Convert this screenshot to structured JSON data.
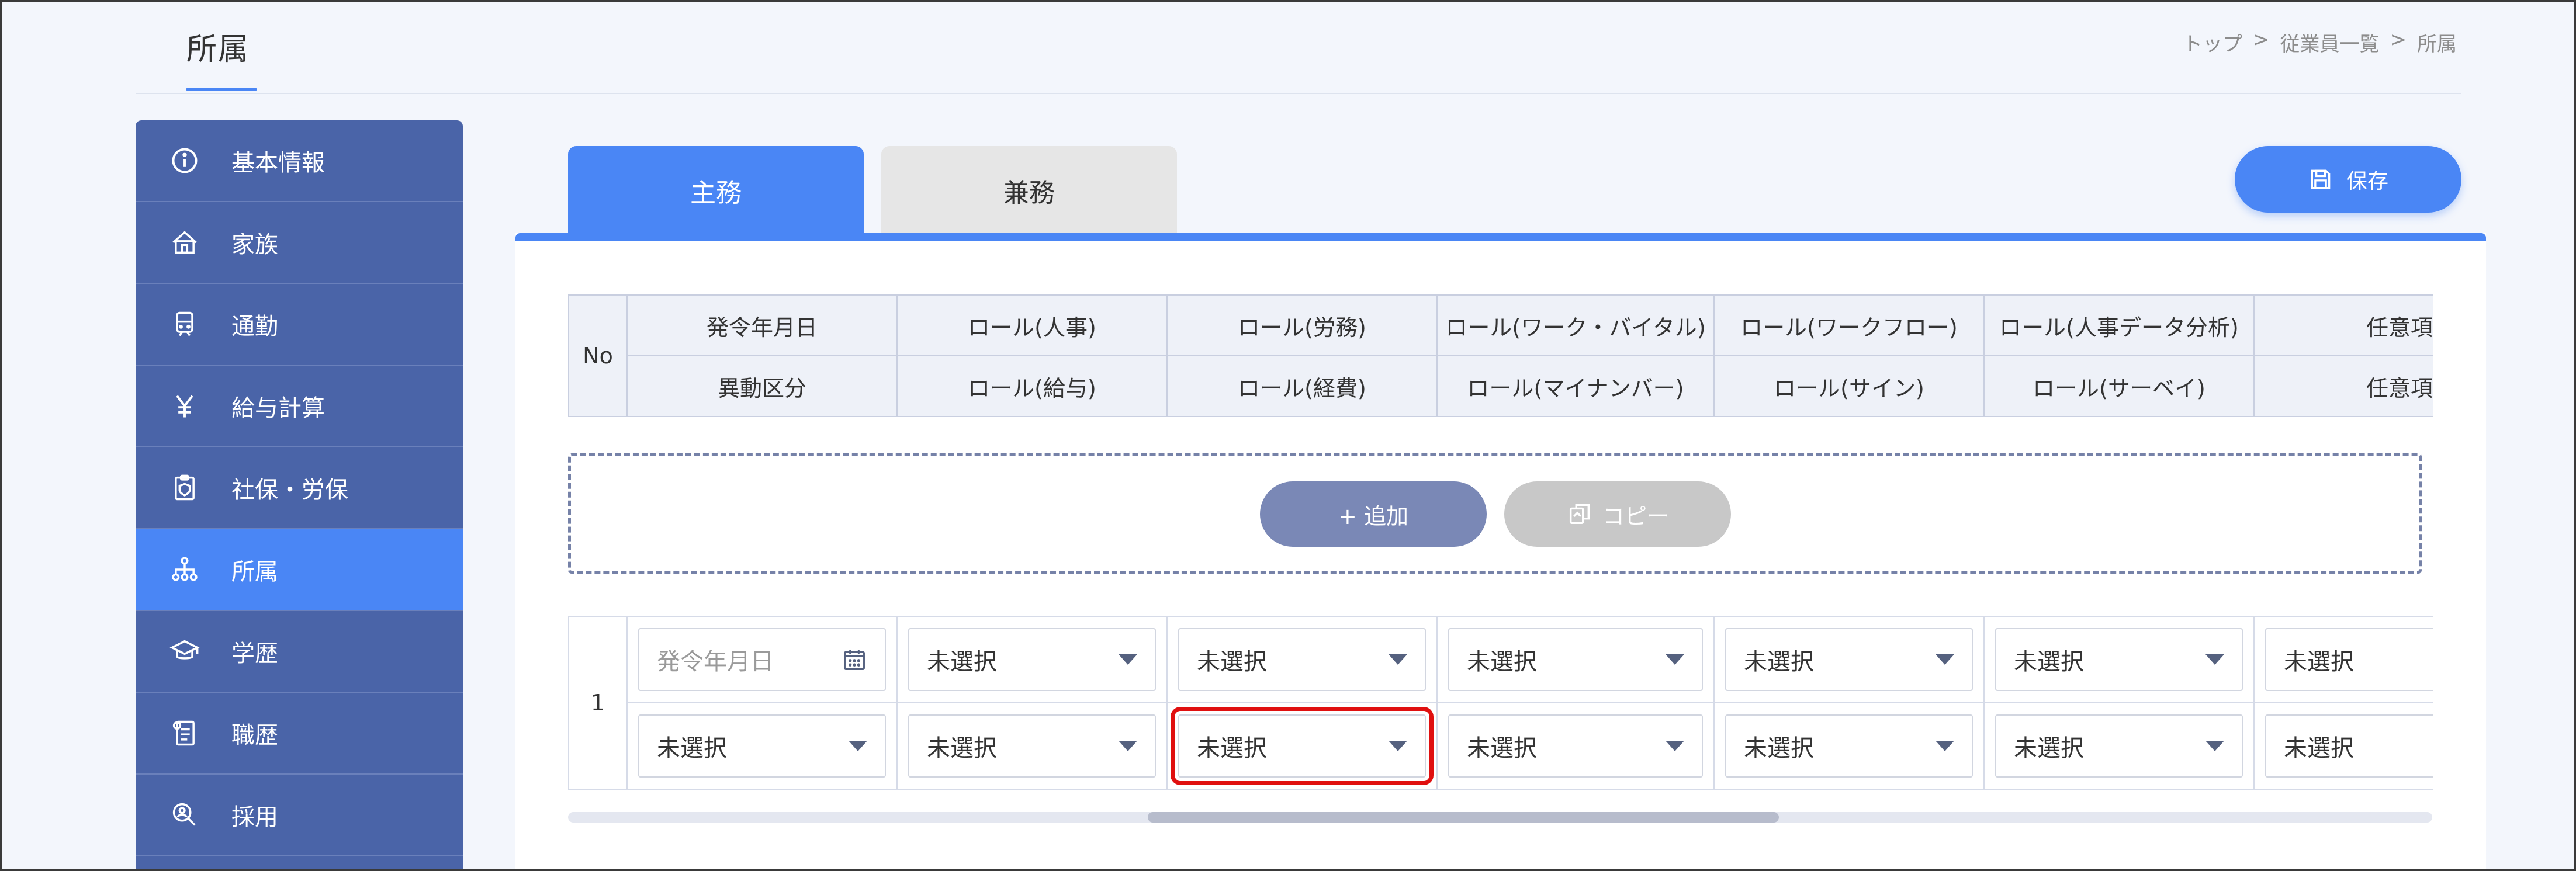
{
  "page": {
    "title": "所属"
  },
  "breadcrumb": [
    "トップ",
    ">",
    "従業員一覧",
    ">",
    "所属"
  ],
  "colors": {
    "accent": "#4a86f5",
    "sidebar": "#4a64a8",
    "highlight": "#e01010"
  },
  "sidebar": {
    "items": [
      {
        "label": "基本情報",
        "icon": "info-icon"
      },
      {
        "label": "家族",
        "icon": "house-icon"
      },
      {
        "label": "通勤",
        "icon": "train-icon"
      },
      {
        "label": "給与計算",
        "icon": "yen-icon"
      },
      {
        "label": "社保・労保",
        "icon": "insurance-icon"
      },
      {
        "label": "所属",
        "icon": "org-chart-icon",
        "active": true
      },
      {
        "label": "学歴",
        "icon": "graduation-cap-icon"
      },
      {
        "label": "職歴",
        "icon": "career-document-icon"
      },
      {
        "label": "採用",
        "icon": "recruit-search-icon"
      }
    ]
  },
  "tabs": {
    "main": "主務",
    "sub": "兼務"
  },
  "toolbar": {
    "save_label": "保存"
  },
  "table": {
    "no_header": "No",
    "header_row1": [
      "発令年月日",
      "ロール(人事)",
      "ロール(労務)",
      "ロール(ワーク・バイタル)",
      "ロール(ワークフロー)",
      "ロール(人事データ分析)",
      "任意項目"
    ],
    "header_row2": [
      "異動区分",
      "ロール(給与)",
      "ロール(経費)",
      "ロール(マイナンバー)",
      "ロール(サイン)",
      "ロール(サーベイ)",
      "任意項目"
    ]
  },
  "actions": {
    "add_label": "+ 追加",
    "copy_label": "コピー"
  },
  "rows": [
    {
      "no": "1",
      "date_placeholder": "発令年月日",
      "row1": [
        "未選択",
        "未選択",
        "未選択",
        "未選択",
        "未選択",
        "未選択"
      ],
      "row2": [
        "未選択",
        "未選択",
        "未選択",
        "未選択",
        "未選択",
        "未選択",
        "未選択"
      ]
    }
  ]
}
